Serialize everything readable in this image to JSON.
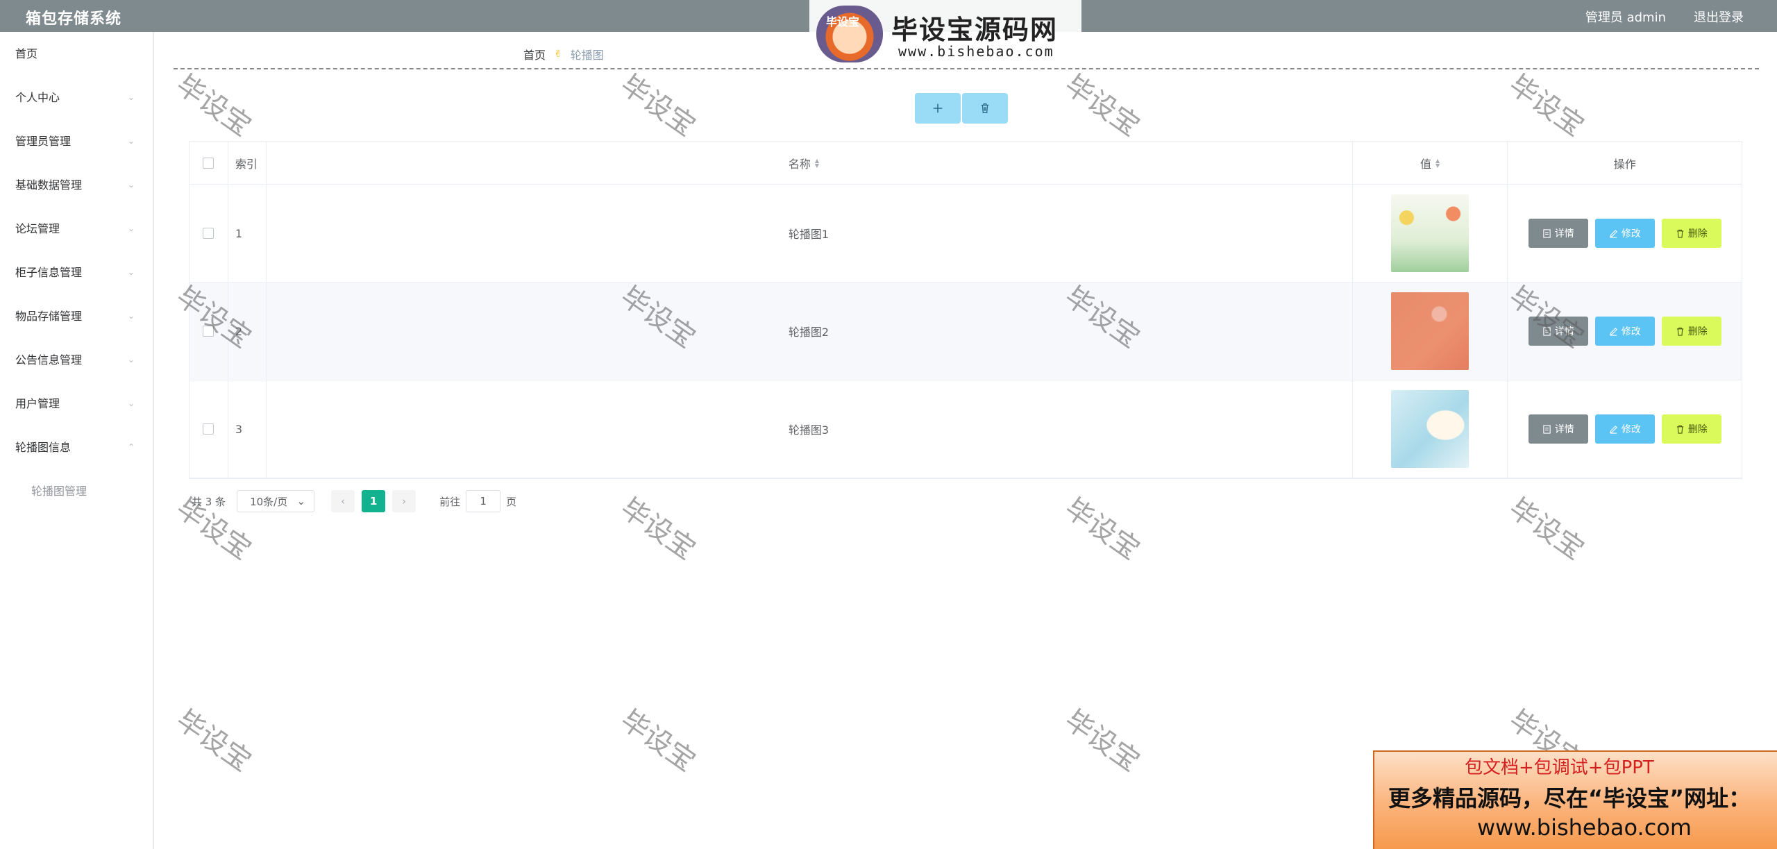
{
  "header": {
    "title": "箱包存储系统",
    "user": "管理员 admin",
    "logout": "退出登录"
  },
  "sidebar": {
    "items": [
      {
        "label": "首页",
        "has_children": false
      },
      {
        "label": "个人中心",
        "has_children": true
      },
      {
        "label": "管理员管理",
        "has_children": true
      },
      {
        "label": "基础数据管理",
        "has_children": true
      },
      {
        "label": "论坛管理",
        "has_children": true
      },
      {
        "label": "柜子信息管理",
        "has_children": true
      },
      {
        "label": "物品存储管理",
        "has_children": true
      },
      {
        "label": "公告信息管理",
        "has_children": true
      },
      {
        "label": "用户管理",
        "has_children": true
      },
      {
        "label": "轮播图信息",
        "has_children": true
      }
    ],
    "sub_item": "轮播图管理"
  },
  "breadcrumb": {
    "home": "首页",
    "current": "轮播图"
  },
  "toolbar": {
    "add_icon": "plus-icon",
    "delete_icon": "trash-icon"
  },
  "table": {
    "columns": {
      "index": "索引",
      "name": "名称",
      "value": "值",
      "actions": "操作"
    },
    "rows": [
      {
        "index": "1",
        "name": "轮播图1"
      },
      {
        "index": "2",
        "name": "轮播图2"
      },
      {
        "index": "3",
        "name": "轮播图3"
      }
    ],
    "actions": {
      "detail": "详情",
      "edit": "修改",
      "delete": "删除"
    }
  },
  "pagination": {
    "total": "共 3 条",
    "page_size": "10条/页",
    "current_page": "1",
    "goto_label": "前往",
    "goto_value": "1",
    "page_suffix": "页"
  },
  "watermark": {
    "text": "毕设宝"
  },
  "logo": {
    "badge": "毕设宝",
    "title": "毕设宝源码网",
    "url": "www.bishebao.com"
  },
  "promo": {
    "line1": "包文档+包调试+包PPT",
    "line2": "更多精品源码，尽在“毕设宝”网址：",
    "line3": "www.bishebao.com"
  },
  "colors": {
    "header_bg": "#7f8a8f",
    "tool_button": "#9adcf6",
    "detail_button": "#7f8a8f",
    "edit_button": "#5cc3f5",
    "delete_button": "#d9fa5a",
    "active_page": "#13b28f"
  }
}
